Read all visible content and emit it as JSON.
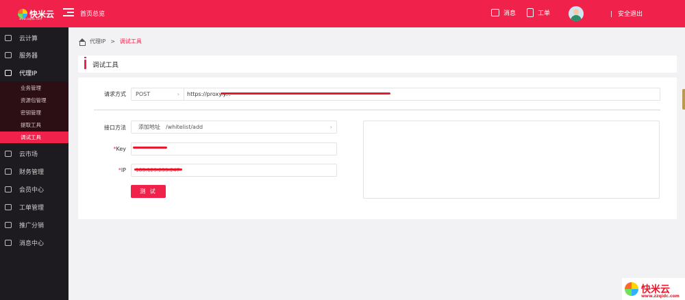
{
  "header": {
    "logo_text": "快米云",
    "logo_sub": "www.zzqidc.com",
    "home_overview": "首页总览",
    "messages": "消息",
    "tickets": "工单",
    "logout_sep": "|",
    "logout": "安全退出"
  },
  "sidebar": {
    "items": [
      {
        "label": "云计算",
        "icon": "cloud-icon"
      },
      {
        "label": "服务器",
        "icon": "server-icon"
      },
      {
        "label": "代理IP",
        "icon": "proxy-icon"
      },
      {
        "label": "云市场",
        "icon": "market-icon"
      },
      {
        "label": "财务管理",
        "icon": "finance-icon"
      },
      {
        "label": "会员中心",
        "icon": "user-icon"
      },
      {
        "label": "工单管理",
        "icon": "ticket-icon"
      },
      {
        "label": "推广分销",
        "icon": "promote-icon"
      },
      {
        "label": "消息中心",
        "icon": "message-icon"
      }
    ],
    "submenu": [
      "业务管理",
      "资源包管理",
      "密钥管理",
      "提取工具",
      "调试工具"
    ]
  },
  "breadcrumb": {
    "parent": "代理IP",
    "separator": ">",
    "current": "调试工具"
  },
  "page_title": "调试工具",
  "form": {
    "request_label": "请求方式",
    "method": "POST",
    "method_arrow": "›",
    "url": "https://proxy.y...",
    "api_label": "接口方法",
    "api_name": "添加地址",
    "api_path": "/whitelist/add",
    "api_arrow": "›",
    "key_label": "Key",
    "key_required": "*",
    "ip_label": "IP",
    "ip_required": "*",
    "ip_value": "183.129.255.247",
    "test_button": "测 试"
  },
  "watermark": {
    "text": "快米云",
    "url": "www.zzqidc.com"
  },
  "colors": {
    "accent": "#f0224b",
    "sidebar_bg": "#1d1b1f",
    "submenu_bg": "#2b0f15"
  }
}
